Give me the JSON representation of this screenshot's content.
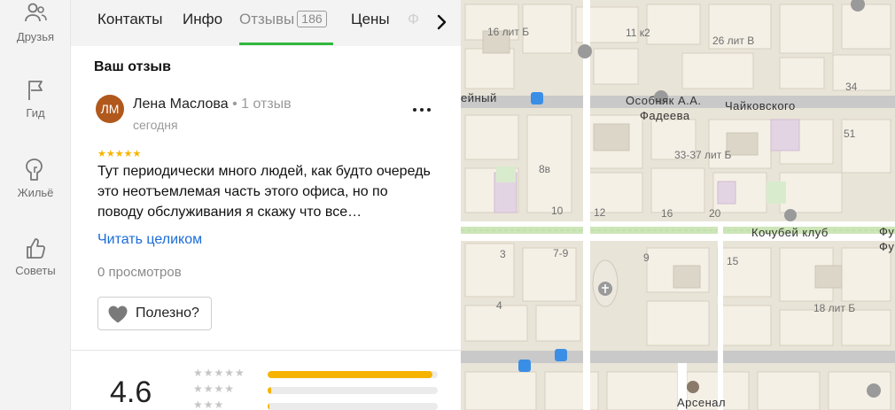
{
  "rail": [
    {
      "name": "rail-friends",
      "icon": "friends-icon",
      "label": "Друзья"
    },
    {
      "name": "rail-guide",
      "icon": "flag-icon",
      "label": "Гид"
    },
    {
      "name": "rail-housing",
      "icon": "housing-icon",
      "label": "Жильё"
    },
    {
      "name": "rail-tips",
      "icon": "thumbs-up-icon",
      "label": "Советы"
    }
  ],
  "tabs": {
    "contacts": "Контакты",
    "info": "Инфо",
    "reviews": "Отзывы",
    "reviews_count": "186",
    "prices": "Цены",
    "photos_partial": "Ф"
  },
  "section": {
    "title": "Ваш отзыв"
  },
  "review": {
    "avatar_initials": "ЛМ",
    "author": "Лена Маслова",
    "author_meta": " • 1 отзыв",
    "date": "сегодня",
    "stars": "★★★★★",
    "text": "Тут периодически много людей, как будто очередь это неотъемлемая часть этого офиса, но по поводу обслуживания я скажу что все…",
    "read_more": "Читать целиком",
    "views": "0 просмотров",
    "useful_label": "Полезно?"
  },
  "rating": {
    "value": "4.6",
    "distribution": [
      {
        "stars": "★★★★★",
        "fraction": 0.97
      },
      {
        "stars": "★★★★",
        "fraction": 0.02
      },
      {
        "stars": "★★★",
        "fraction": 0.01
      }
    ]
  },
  "map": {
    "labels": {
      "l1": "16 лит Б",
      "l2": "11 к2",
      "l3": "26 лит В",
      "l4": "Особняк А.А.",
      "l5": "Фадеева",
      "l6": "Чайковского",
      "l7": "33-37 лит Б",
      "l8": "8в",
      "l9": "10",
      "l10": "12",
      "l11": "16",
      "l12": "20",
      "l13": "Кочубей клуб",
      "l14": "7-9",
      "l15": "3",
      "l16": "9",
      "l17": "15",
      "l18": "18 лит Б",
      "l19": "4",
      "l20": "Арсенал",
      "l21": "34",
      "l22": "51",
      "l23": "ейный",
      "l24": "Фу",
      "l25": "Фу"
    }
  },
  "colors": {
    "accent_green": "#32b83f",
    "star_yellow": "#f6b400",
    "link_blue": "#1b6cd8",
    "avatar_brown": "#b1581c"
  }
}
